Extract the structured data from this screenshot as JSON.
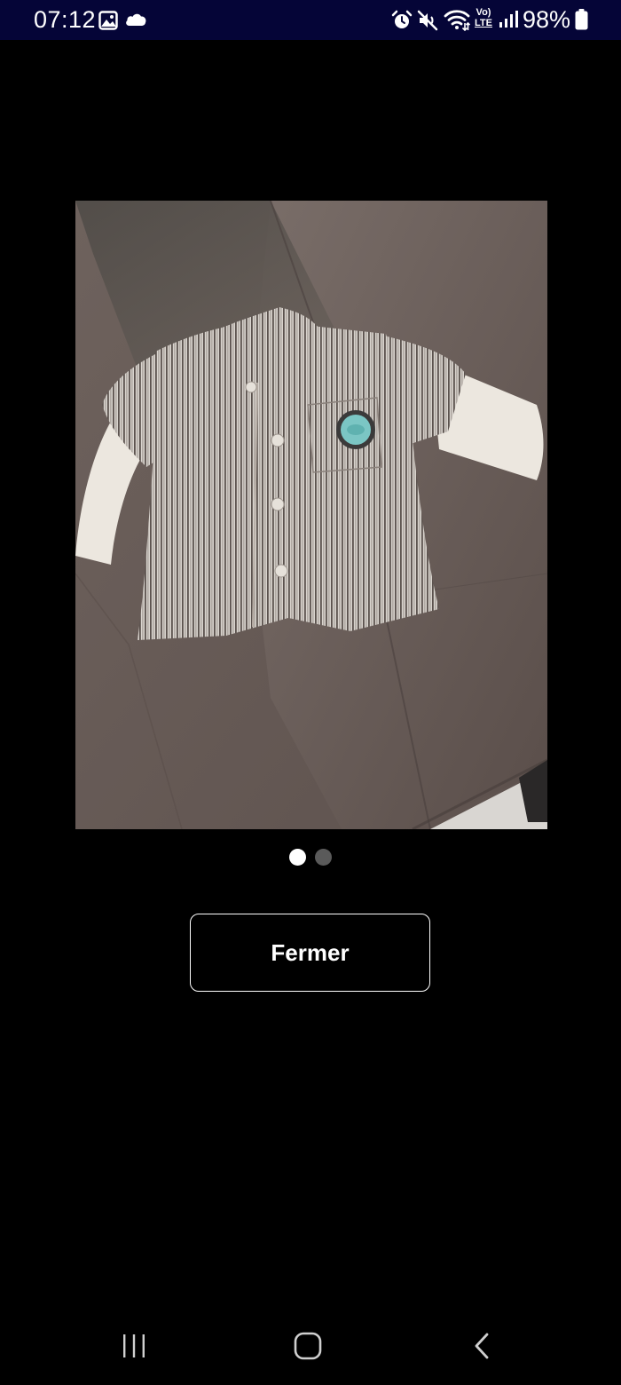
{
  "status_bar": {
    "time": "07:12",
    "battery_percent": "98%",
    "background": "#050537",
    "left_icons": [
      "gallery-icon",
      "cloud-icon"
    ],
    "right_icons": [
      "alarm-icon",
      "mute-icon",
      "wifi-icon",
      "volte-lte-icon",
      "signal-icon",
      "battery-icon"
    ],
    "volte_label": "Vo)",
    "lte_label": "LTE"
  },
  "viewer": {
    "image_subject": "striped baby shirt with long white sleeves on wooden table",
    "total_images": 2,
    "current_index": 1
  },
  "close_button": {
    "label": "Fermer"
  },
  "nav_bar": {
    "buttons": [
      "recents-icon",
      "home-icon",
      "back-icon"
    ]
  }
}
